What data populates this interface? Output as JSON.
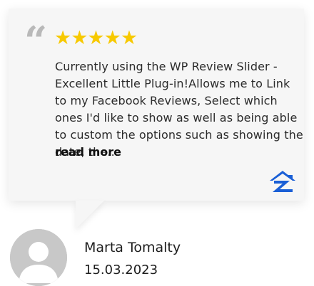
{
  "review": {
    "quote_mark": "“",
    "stars": "★★★★★",
    "rating": 5,
    "text": "Currently using the WP Review Slider - Excellent Little Plug-in!Allows me to Link to my Facebook Reviews, Select which ones I'd like to show as well as being able to custom the options such as showing the date, the...",
    "read_more_label": "read more",
    "source_icon": "zillow-logo-icon"
  },
  "author": {
    "name": "Marta Tomalty",
    "date": "15.03.2023",
    "avatar_icon": "user-avatar-placeholder-icon"
  },
  "colors": {
    "star": "#f7c900",
    "card_bg": "#f6f6f6",
    "quote": "#b9b9b9",
    "logo_blue": "#1a5fd6"
  }
}
